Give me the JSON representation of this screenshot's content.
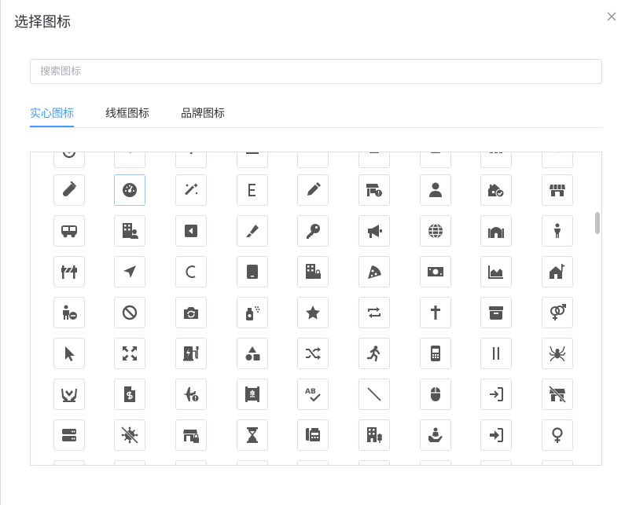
{
  "dialog": {
    "title": "选择图标"
  },
  "search": {
    "placeholder": "搜索图标",
    "value": ""
  },
  "tabs": [
    {
      "label": "实心图标",
      "active": true
    },
    {
      "label": "线框图标",
      "active": false
    },
    {
      "label": "品牌图标",
      "active": false
    }
  ],
  "colors": {
    "accent": "#409eff",
    "icon": "#555555",
    "border": "#dcdfe6"
  },
  "icons": {
    "rows": [
      [
        "circle-partial-icon",
        "pen-partial-icon",
        "arrow-partial-icon",
        "box-partial-icon",
        "bar-partial-icon",
        "square-partial-icon",
        "bottle-partial-icon",
        "dots-partial-icon",
        "ring-partial-icon"
      ],
      [
        "vial-icon",
        "gauge-icon",
        "magic-wand-icon",
        "letter-e-icon",
        "pen-icon",
        "shop-alert-icon",
        "user-icon",
        "house-check-icon",
        "shop-icon"
      ],
      [
        "bus-icon",
        "building-user-icon",
        "caret-left-square-icon",
        "marker-icon",
        "key-icon",
        "bullhorn-icon",
        "globe-icon",
        "mosque-icon",
        "child-icon"
      ],
      [
        "road-barrier-icon",
        "location-arrow-icon",
        "letter-c-icon",
        "tablet-icon",
        "building-lock-icon",
        "pizza-icon",
        "money-bill-icon",
        "chart-area-icon",
        "house-flag-icon"
      ],
      [
        "person-minus-icon",
        "ban-icon",
        "camera-rotate-icon",
        "spray-can-icon",
        "star-icon",
        "repeat-icon",
        "cross-icon",
        "box-archive-icon",
        "venus-mars-icon"
      ],
      [
        "arrow-pointer-icon",
        "expand-icon",
        "charging-station-icon",
        "shapes-icon",
        "shuffle-icon",
        "person-running-icon",
        "mobile-icon",
        "pause-icon",
        "spider-icon"
      ],
      [
        "hands-holding-icon",
        "file-invoice-dollar-icon",
        "plane-alert-icon",
        "scroll-torah-icon",
        "spell-check-icon",
        "slash-icon",
        "mouse-icon",
        "sign-in-icon",
        "shop-slash-icon"
      ],
      [
        "server-icon",
        "virus-slash-icon",
        "shop-lock-icon",
        "hourglass-icon",
        "phone-fax-icon",
        "building-wheat-icon",
        "hand-child-icon",
        "right-to-bracket-icon",
        "venus-icon"
      ],
      [
        "blank-icon",
        "blank-icon",
        "blank-icon",
        "blank-icon",
        "blank-icon",
        "blank-icon",
        "blank-icon",
        "blank-icon",
        "blank-icon"
      ]
    ],
    "selected": [
      1,
      1
    ]
  }
}
